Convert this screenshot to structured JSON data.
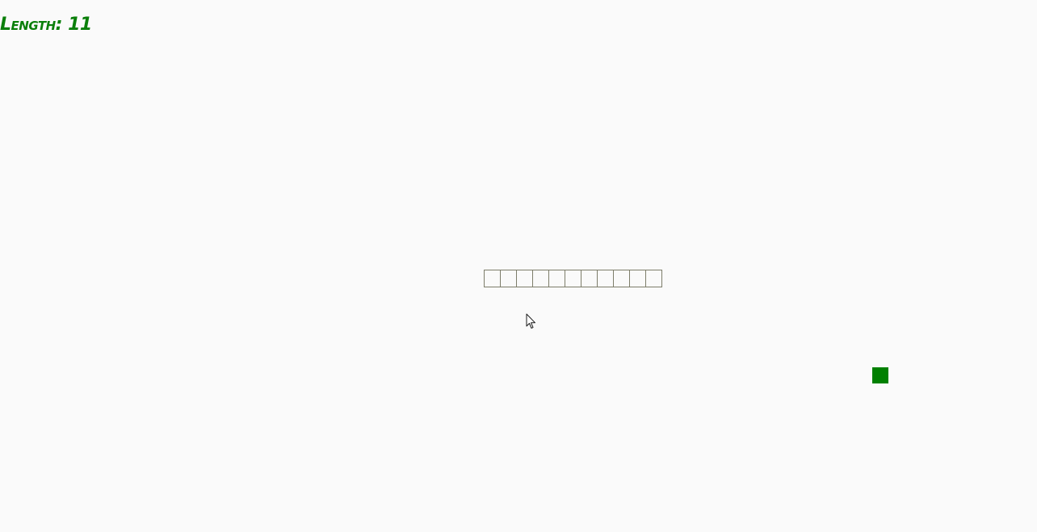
{
  "score": {
    "label": "Length:",
    "value": "11"
  },
  "snake": {
    "length": 11,
    "direction": "horizontal",
    "segment_border_color": "#7d7d6a"
  },
  "food": {
    "color": "#008000"
  },
  "colors": {
    "background": "#fafafa",
    "score_text": "#0a7f0a"
  },
  "cursor": {
    "icon": "mouse-pointer-icon"
  }
}
